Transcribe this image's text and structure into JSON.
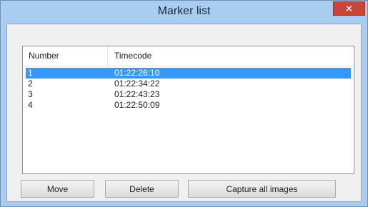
{
  "window": {
    "title": "Marker list",
    "close_glyph": "✕"
  },
  "list": {
    "columns": [
      "Number",
      "Timecode"
    ],
    "rows": [
      {
        "number": "1",
        "timecode": "01:22:26:10",
        "selected": true
      },
      {
        "number": "2",
        "timecode": "01:22:34:22",
        "selected": false
      },
      {
        "number": "3",
        "timecode": "01:22:43:23",
        "selected": false
      },
      {
        "number": "4",
        "timecode": "01:22:50:09",
        "selected": false
      }
    ]
  },
  "buttons": {
    "move": "Move",
    "delete": "Delete",
    "capture": "Capture all images"
  },
  "colors": {
    "titlebar": "#a9ccf1",
    "close": "#c7453b",
    "selection": "#3399ff"
  }
}
